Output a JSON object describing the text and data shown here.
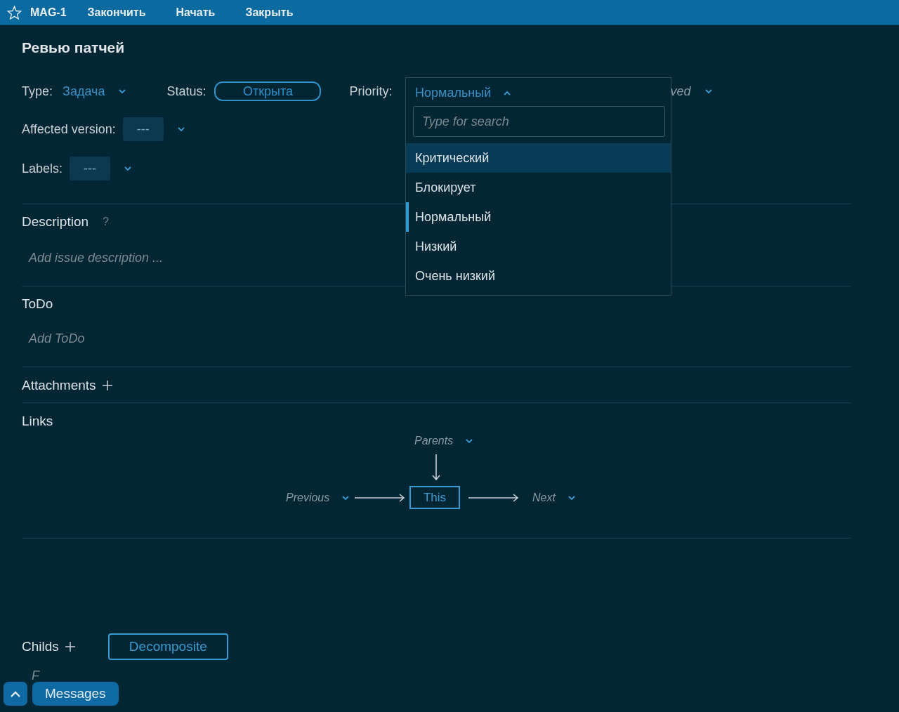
{
  "top_bar": {
    "issue_id": "MAG-1",
    "actions": [
      "Закончить",
      "Начать",
      "Закрыть"
    ]
  },
  "title": "Ревью патчей",
  "field_rows": [
    [
      {
        "label": "Type:",
        "value": "Задача",
        "kind": "link"
      },
      {
        "label": "Status:",
        "value": "Открыта",
        "kind": "pill"
      },
      {
        "label": "Priority:",
        "kind": "covered"
      },
      {
        "value": "ved",
        "kind": "partial"
      }
    ],
    [
      {
        "label": "Affected version:",
        "value": "---",
        "kind": "box"
      }
    ],
    [
      {
        "label": "Labels:",
        "value": "---",
        "kind": "box"
      }
    ]
  ],
  "priority_dropdown": {
    "value": "Нормальный",
    "placeholder": "Type for search",
    "options": [
      {
        "label": "Критический",
        "highlighted": true,
        "selected": false
      },
      {
        "label": "Блокирует",
        "highlighted": false,
        "selected": false
      },
      {
        "label": "Нормальный",
        "highlighted": false,
        "selected": true
      },
      {
        "label": "Низкий",
        "highlighted": false,
        "selected": false
      },
      {
        "label": "Очень низкий",
        "highlighted": false,
        "selected": false
      }
    ]
  },
  "description": {
    "title": "Description",
    "help": "?",
    "placeholder": "Add issue description ..."
  },
  "todo": {
    "title": "ToDo",
    "placeholder": "Add ToDo"
  },
  "attachments": {
    "title": "Attachments"
  },
  "links": {
    "title": "Links",
    "parents": "Parents",
    "previous": "Previous",
    "current": "This",
    "next": "Next"
  },
  "childs": {
    "title": "Childs",
    "button": "Decomposite",
    "placeholder": "F"
  },
  "messages_button": "Messages"
}
